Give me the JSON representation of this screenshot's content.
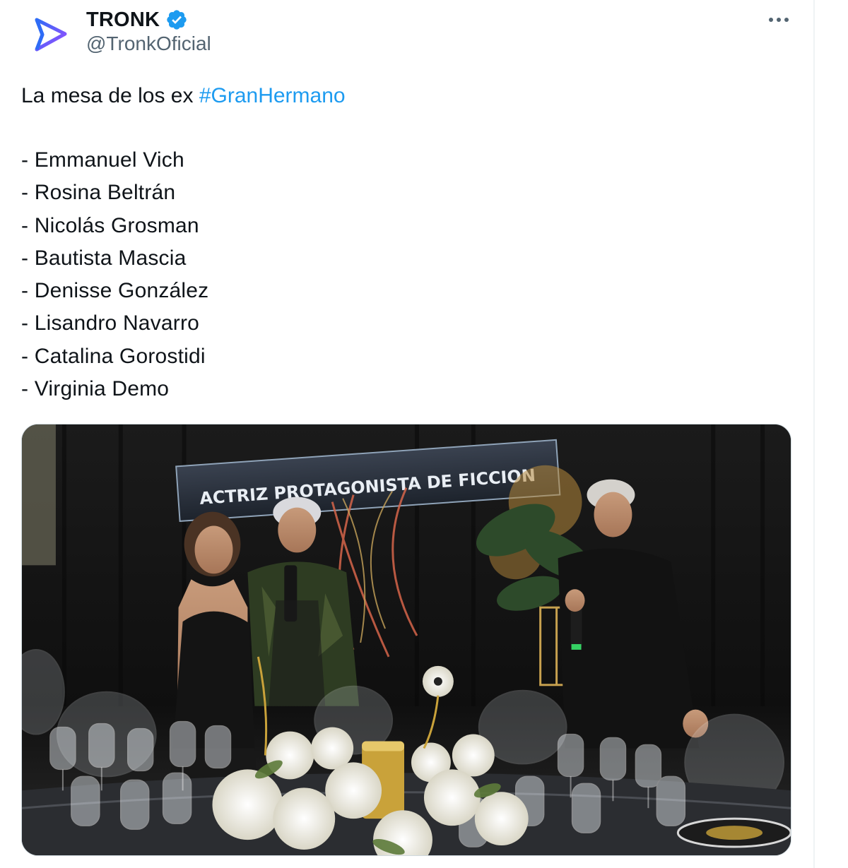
{
  "tweet": {
    "author": {
      "display_name": "TRONK",
      "handle": "@TronkOficial",
      "avatar_icon": "tronk-play-logo-icon",
      "verified_icon": "verified-badge-icon"
    },
    "more_icon": "more-options-icon",
    "text_intro": "La mesa de los ex ",
    "hashtag": "#GranHermano",
    "list": [
      "- Emmanuel Vich",
      "- Rosina Beltrán",
      "- Nicolás Grosman",
      "- Bautista Mascia",
      "- Denisse González",
      "- Lisandro Navarro",
      "- Catalina Gorostidi",
      "- Virginia Demo"
    ],
    "media": {
      "banner_text": "ACTRIZ PROTAGONISTA DE FICCION"
    }
  },
  "colors": {
    "link": "#1d9bf0",
    "text": "#0f1419",
    "secondary": "#536471",
    "verified": "#1d9bf0",
    "logo_gradient_start": "#2e6cf6",
    "logo_gradient_end": "#9b4dff"
  }
}
